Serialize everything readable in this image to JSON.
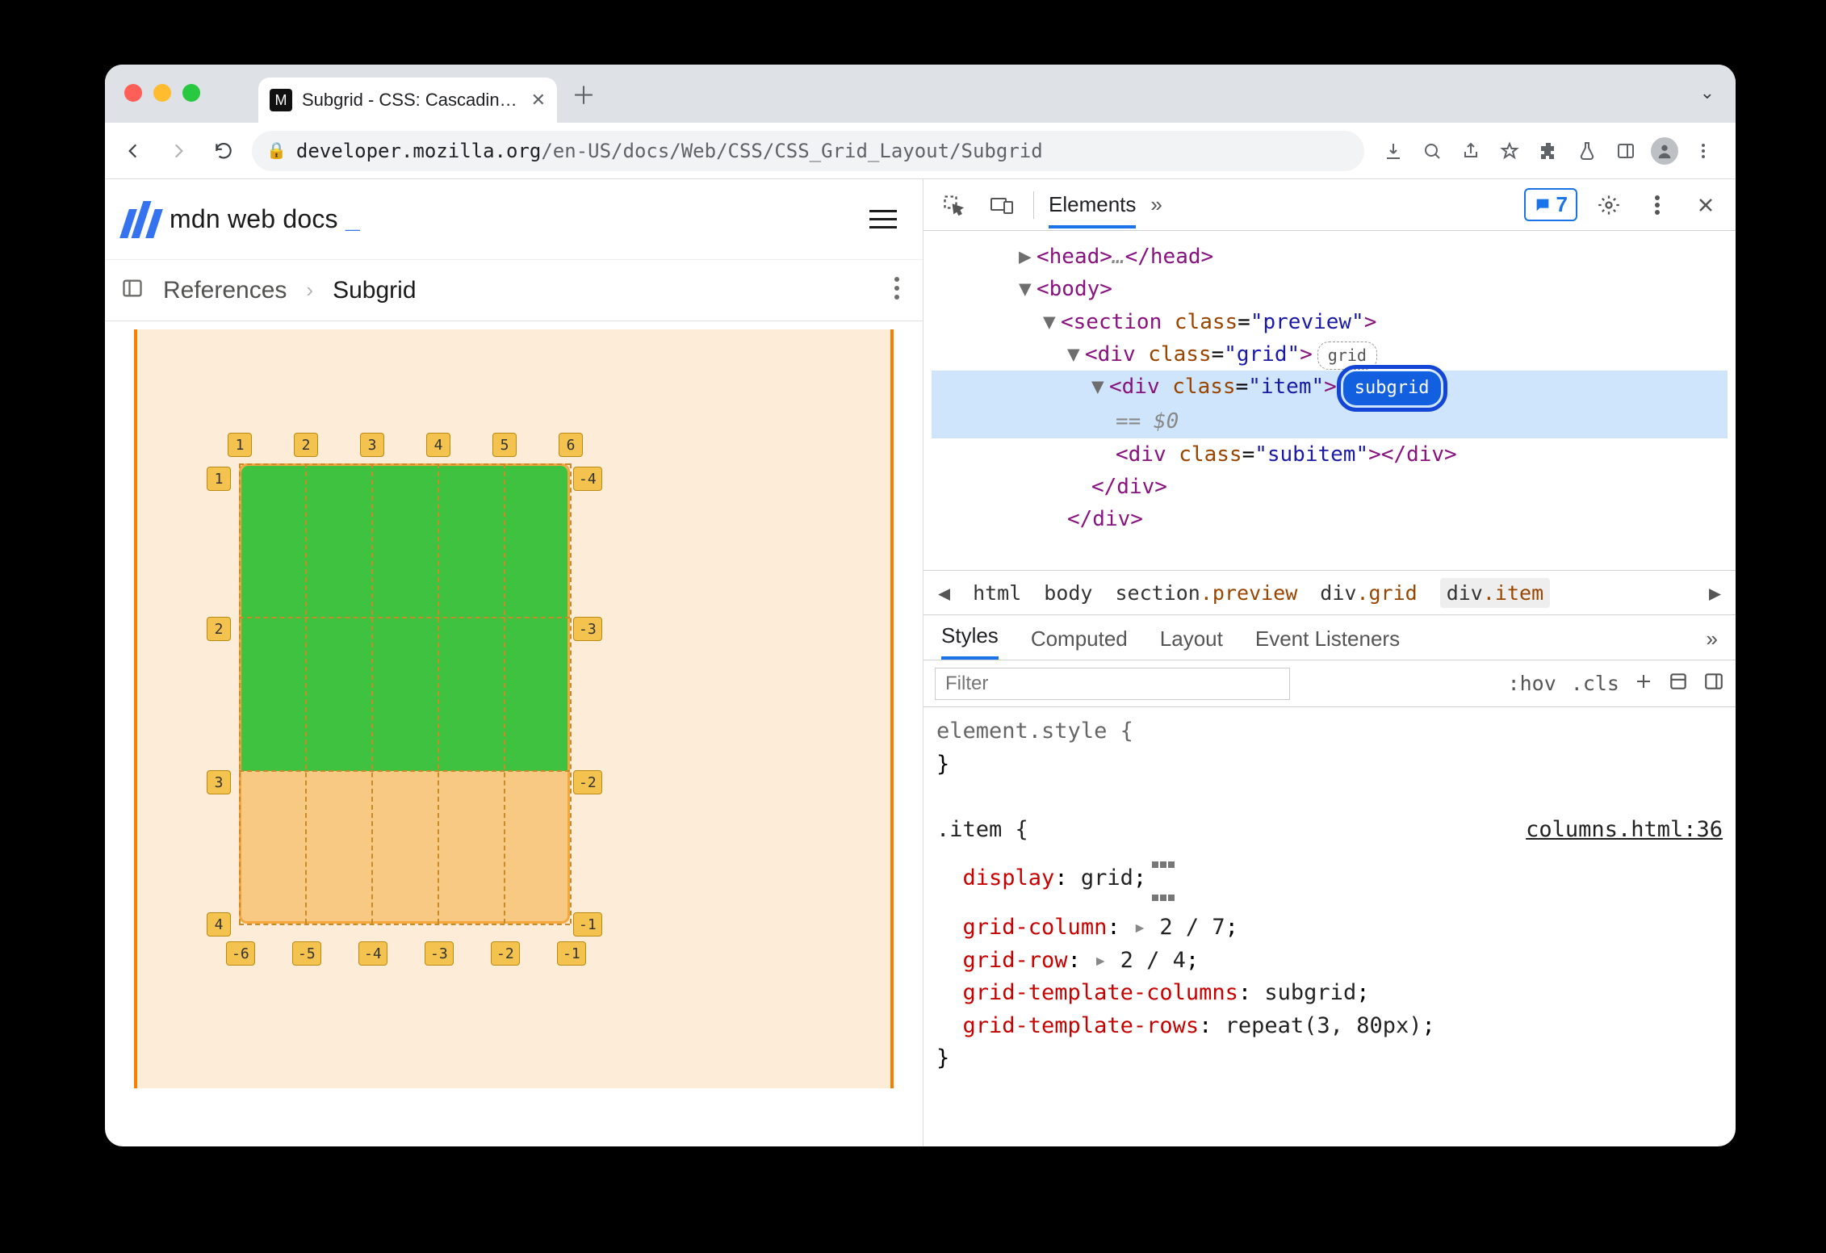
{
  "browser": {
    "tab_title": "Subgrid - CSS: Cascading Style",
    "url_host": "developer.mozilla.org",
    "url_path": "/en-US/docs/Web/CSS/CSS_Grid_Layout/Subgrid",
    "issues_count": "7"
  },
  "mdn": {
    "logo_text": "mdn web docs",
    "blink": "_",
    "breadcrumbs": {
      "root": "References",
      "current": "Subgrid"
    }
  },
  "grid_overlay": {
    "top_cols": [
      "1",
      "2",
      "3",
      "4",
      "5",
      "6"
    ],
    "left_rows": [
      "1",
      "2",
      "3",
      "4"
    ],
    "right_rows": [
      "-4",
      "-3",
      "-2",
      "-1"
    ],
    "bottom_cols": [
      "-6",
      "-5",
      "-4",
      "-3",
      "-2",
      "-1"
    ]
  },
  "devtools": {
    "top_tab_active": "Elements",
    "dom": {
      "head_open": "<head>",
      "head_ell": "…",
      "head_close": "</head>",
      "body_open": "<body>",
      "section_open": "<section class=\"preview\">",
      "grid_open": "<div class=\"grid\">",
      "grid_badge": "grid",
      "item_open": "<div class=\"item\">",
      "subgrid_badge": "subgrid",
      "eq": "== $0",
      "subitem": "<div class=\"subitem\"></div>",
      "div_close": "</div>",
      "div_close2": "</div>"
    },
    "crumbs": [
      "html",
      "body",
      "section.preview",
      "div.grid",
      "div.item"
    ],
    "subtabs": [
      "Styles",
      "Computed",
      "Layout",
      "Event Listeners"
    ],
    "filter_placeholder": "Filter",
    "hov": ":hov",
    "cls": ".cls",
    "style_src": "columns.html:36",
    "rules": {
      "elstyle": "element.style {",
      "close": "}",
      "item_sel": ".item {",
      "p1": "display",
      "v1": "grid",
      "p2": "grid-column",
      "v2": "2 / 7",
      "p3": "grid-row",
      "v3": "2 / 4",
      "p4": "grid-template-columns",
      "v4": "subgrid",
      "p5": "grid-template-rows",
      "v5": "repeat(3, 80px)"
    }
  }
}
